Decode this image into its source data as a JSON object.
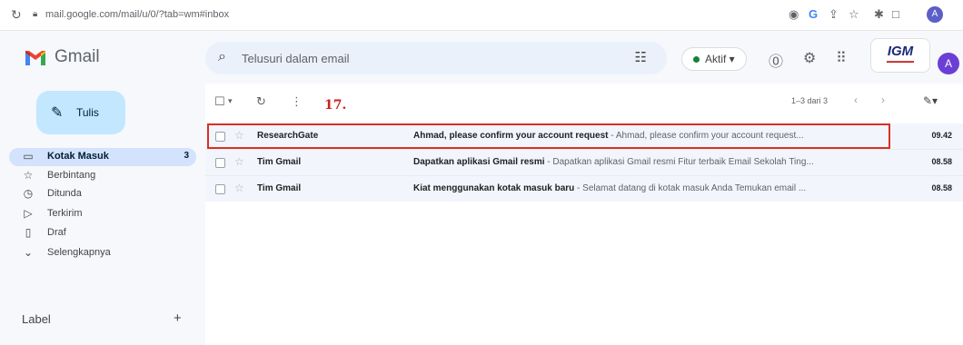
{
  "browser": {
    "url": "mail.google.com/mail/u/0/?tab=wm#inbox",
    "profile_initial": "A"
  },
  "app": {
    "name": "Gmail",
    "search_placeholder": "Telusuri dalam email",
    "status_label": "Aktif",
    "school_badge": "IGM",
    "avatar_initial": "A"
  },
  "sidebar": {
    "compose_label": "Tulis",
    "items": [
      {
        "label": "Kotak Masuk",
        "count": "3",
        "icon": "inbox-icon"
      },
      {
        "label": "Berbintang",
        "icon": "star-icon"
      },
      {
        "label": "Ditunda",
        "icon": "clock-icon"
      },
      {
        "label": "Terkirim",
        "icon": "send-icon"
      },
      {
        "label": "Draf",
        "icon": "draft-icon"
      },
      {
        "label": "Selengkapnya",
        "icon": "chevron-down-icon"
      }
    ],
    "labels_heading": "Label"
  },
  "toolbar": {
    "annotation_number": "17.",
    "pagination": "1–3 dari 3"
  },
  "emails": [
    {
      "sender": "ResearchGate",
      "subject": "Ahmad, please confirm your account request",
      "snippet": " - Ahmad, please confirm your account request...",
      "time": "09.42"
    },
    {
      "sender": "Tim Gmail",
      "subject": "Dapatkan aplikasi Gmail resmi",
      "snippet": " - Dapatkan aplikasi Gmail resmi Fitur terbaik Email Sekolah Ting...",
      "time": "08.58"
    },
    {
      "sender": "Tim Gmail",
      "subject": "Kiat menggunakan kotak masuk baru",
      "snippet": " - Selamat datang di kotak masuk Anda Temukan email ...",
      "time": "08.58"
    }
  ],
  "colors": {
    "compose_bg": "#c2e7ff",
    "active_nav_bg": "#d3e3fd",
    "highlight_border": "#d93025",
    "annotation_text": "#c5221f"
  }
}
